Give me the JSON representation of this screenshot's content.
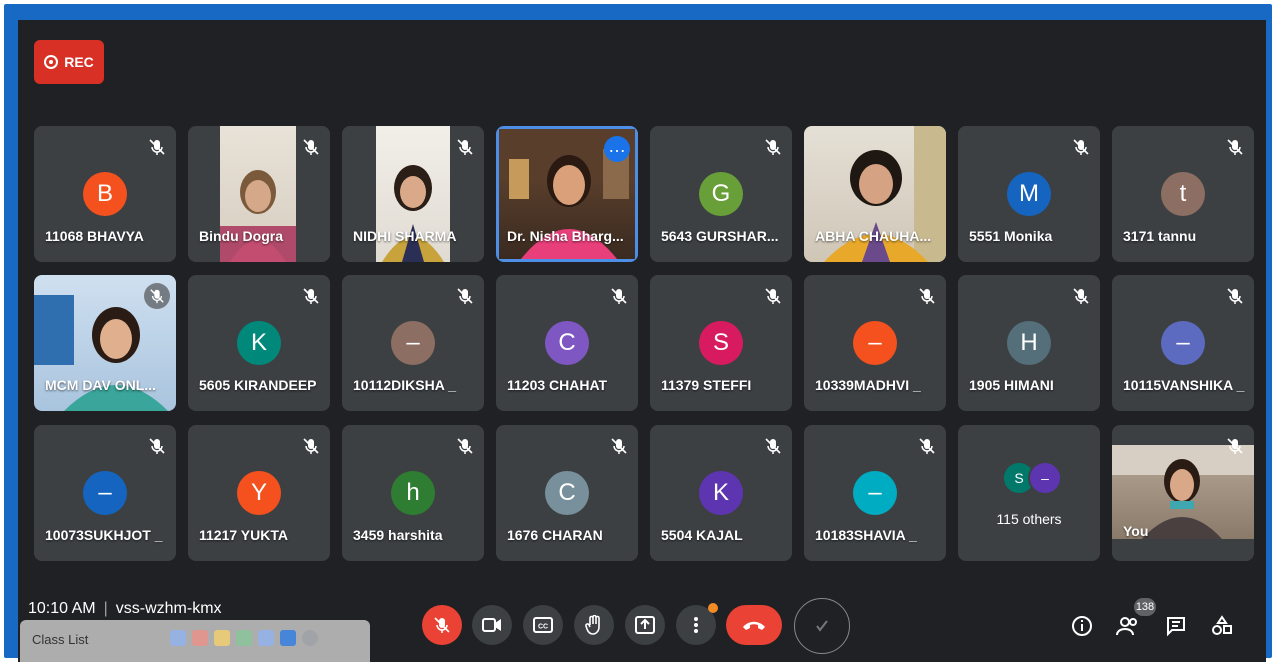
{
  "recording": {
    "label": "REC"
  },
  "tiles": [
    {
      "name": "11068 BHAVYA",
      "initial": "B",
      "color": "#f4511e"
    },
    {
      "name": "Bindu Dogra"
    },
    {
      "name": "NIDHI SHARMA"
    },
    {
      "name": "Dr. Nisha Bharg..."
    },
    {
      "name": "5643 GURSHAR...",
      "initial": "G",
      "color": "#689f38"
    },
    {
      "name": "ABHA CHAUHA..."
    },
    {
      "name": "5551 Monika",
      "initial": "M",
      "color": "#1565c0"
    },
    {
      "name": "3171 tannu",
      "initial": "t",
      "color": "#8d6e63"
    },
    {
      "name": "MCM DAV ONL..."
    },
    {
      "name": "5605 KIRANDEEP",
      "initial": "K",
      "color": "#00897b"
    },
    {
      "name": "10112DIKSHA _",
      "initial": "–",
      "color": "#8d6e63"
    },
    {
      "name": "11203 CHAHAT",
      "initial": "C",
      "color": "#7e57c2"
    },
    {
      "name": "11379 STEFFI",
      "initial": "S",
      "color": "#d81b60"
    },
    {
      "name": "10339MADHVI _",
      "initial": "–",
      "color": "#f4511e"
    },
    {
      "name": "1905 HIMANI",
      "initial": "H",
      "color": "#546e7a"
    },
    {
      "name": "10115VANSHIKA _",
      "initial": "–",
      "color": "#5c6bc0"
    },
    {
      "name": "10073SUKHJOT _",
      "initial": "–",
      "color": "#1565c0"
    },
    {
      "name": "11217 YUKTA",
      "initial": "Y",
      "color": "#f4511e"
    },
    {
      "name": "3459 harshita",
      "initial": "h",
      "color": "#2e7d32"
    },
    {
      "name": "1676 CHARAN",
      "initial": "C",
      "color": "#78909c"
    },
    {
      "name": "5504 KAJAL",
      "initial": "K",
      "color": "#5e35b1"
    },
    {
      "name": "10183SHAVIA _",
      "initial": "–",
      "color": "#00acc1"
    },
    {
      "name": "115 others",
      "initial_1": "S",
      "initial_2": "–"
    },
    {
      "name": "You"
    }
  ],
  "meeting": {
    "time": "10:10 AM",
    "code": "vss-wzhm-kmx"
  },
  "overlay": {
    "class_list": "Class List"
  },
  "participants_count": "138",
  "colors": {
    "accent": "#1a73e8",
    "danger": "#ea4335",
    "tile": "#3c4043",
    "background": "#202124"
  }
}
